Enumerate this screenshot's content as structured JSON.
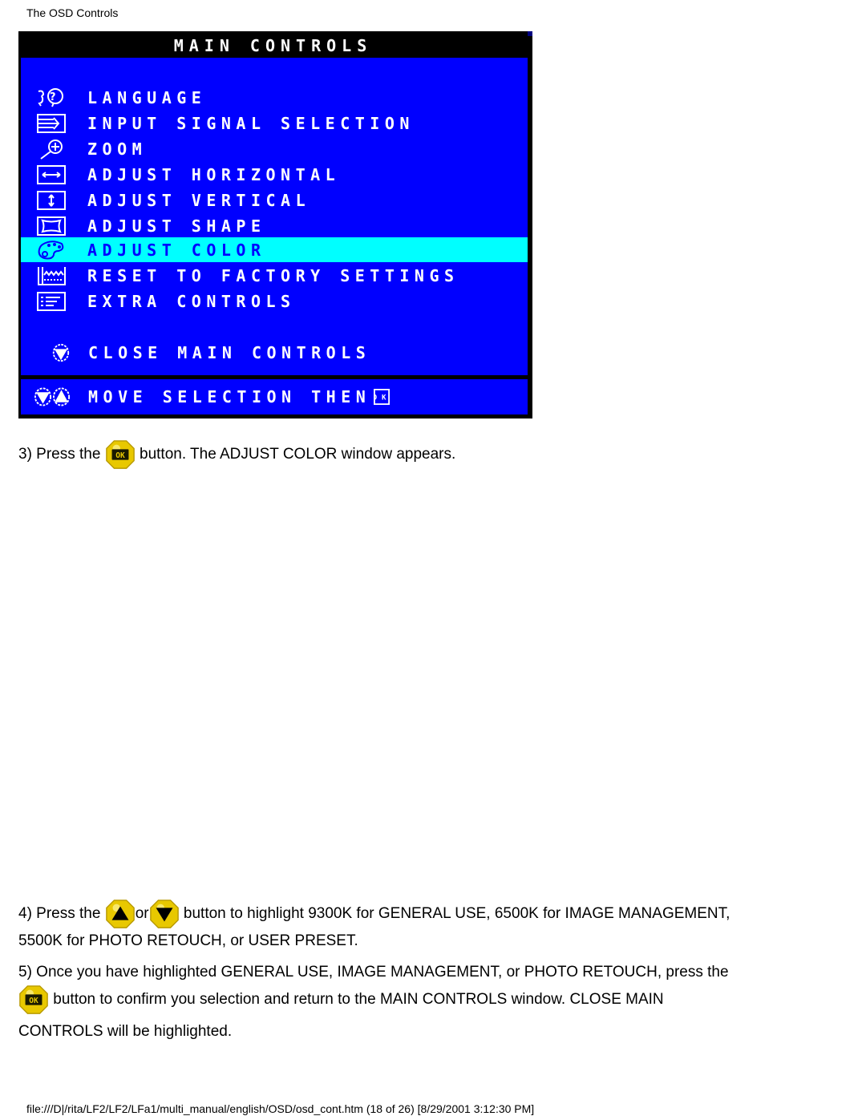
{
  "page": {
    "header_title": "The OSD Controls",
    "footer_url": "file:///D|/rita/LF2/LF2/LFa1/multi_manual/english/OSD/osd_cont.htm (18 of 26) [8/29/2001 3:12:30 PM]"
  },
  "osd": {
    "title": "MAIN CONTROLS",
    "colors": {
      "background": "#0000ff",
      "selected": "#00ffff",
      "frame": "#000000",
      "text": "#ffffff"
    },
    "items": [
      {
        "label": "LANGUAGE",
        "icon": "language-icon",
        "selected": false
      },
      {
        "label": "INPUT SIGNAL SELECTION",
        "icon": "input-signal-icon",
        "selected": false
      },
      {
        "label": "ZOOM",
        "icon": "zoom-icon",
        "selected": false
      },
      {
        "label": "ADJUST HORIZONTAL",
        "icon": "horizontal-arrows-icon",
        "selected": false
      },
      {
        "label": "ADJUST VERTICAL",
        "icon": "vertical-arrows-icon",
        "selected": false
      },
      {
        "label": "ADJUST SHAPE",
        "icon": "shape-icon",
        "selected": false
      },
      {
        "label": "ADJUST COLOR",
        "icon": "palette-icon",
        "selected": true
      },
      {
        "label": "RESET TO FACTORY SETTINGS",
        "icon": "factory-reset-icon",
        "selected": false
      },
      {
        "label": "EXTRA CONTROLS",
        "icon": "extra-controls-icon",
        "selected": false
      }
    ],
    "close": {
      "label": "CLOSE MAIN CONTROLS",
      "icon": "down-button-icon"
    },
    "footer": {
      "label": "MOVE SELECTION THEN",
      "icons": [
        "down-button-icon",
        "up-button-icon",
        "ok-icon"
      ]
    }
  },
  "steps": [
    {
      "prefix": "3) Press the",
      "button": "ok-button",
      "suffix": "button. The ADJUST COLOR window appears."
    },
    {
      "prefix": "4) Press the",
      "button1": "up-button",
      "middle": "or",
      "button2": "down-button",
      "suffix": "button to highlight 9300K for GENERAL USE, 6500K for IMAGE MANAGEMENT,",
      "line2": "5500K for PHOTO RETOUCH, or USER PRESET."
    },
    {
      "line1": "5) Once you have highlighted GENERAL USE, IMAGE MANAGEMENT, or PHOTO RETOUCH, press the",
      "button": "ok-button",
      "line2": "button to confirm you selection and return to the MAIN CONTROLS window. CLOSE MAIN",
      "line3": "CONTROLS will be highlighted."
    }
  ]
}
